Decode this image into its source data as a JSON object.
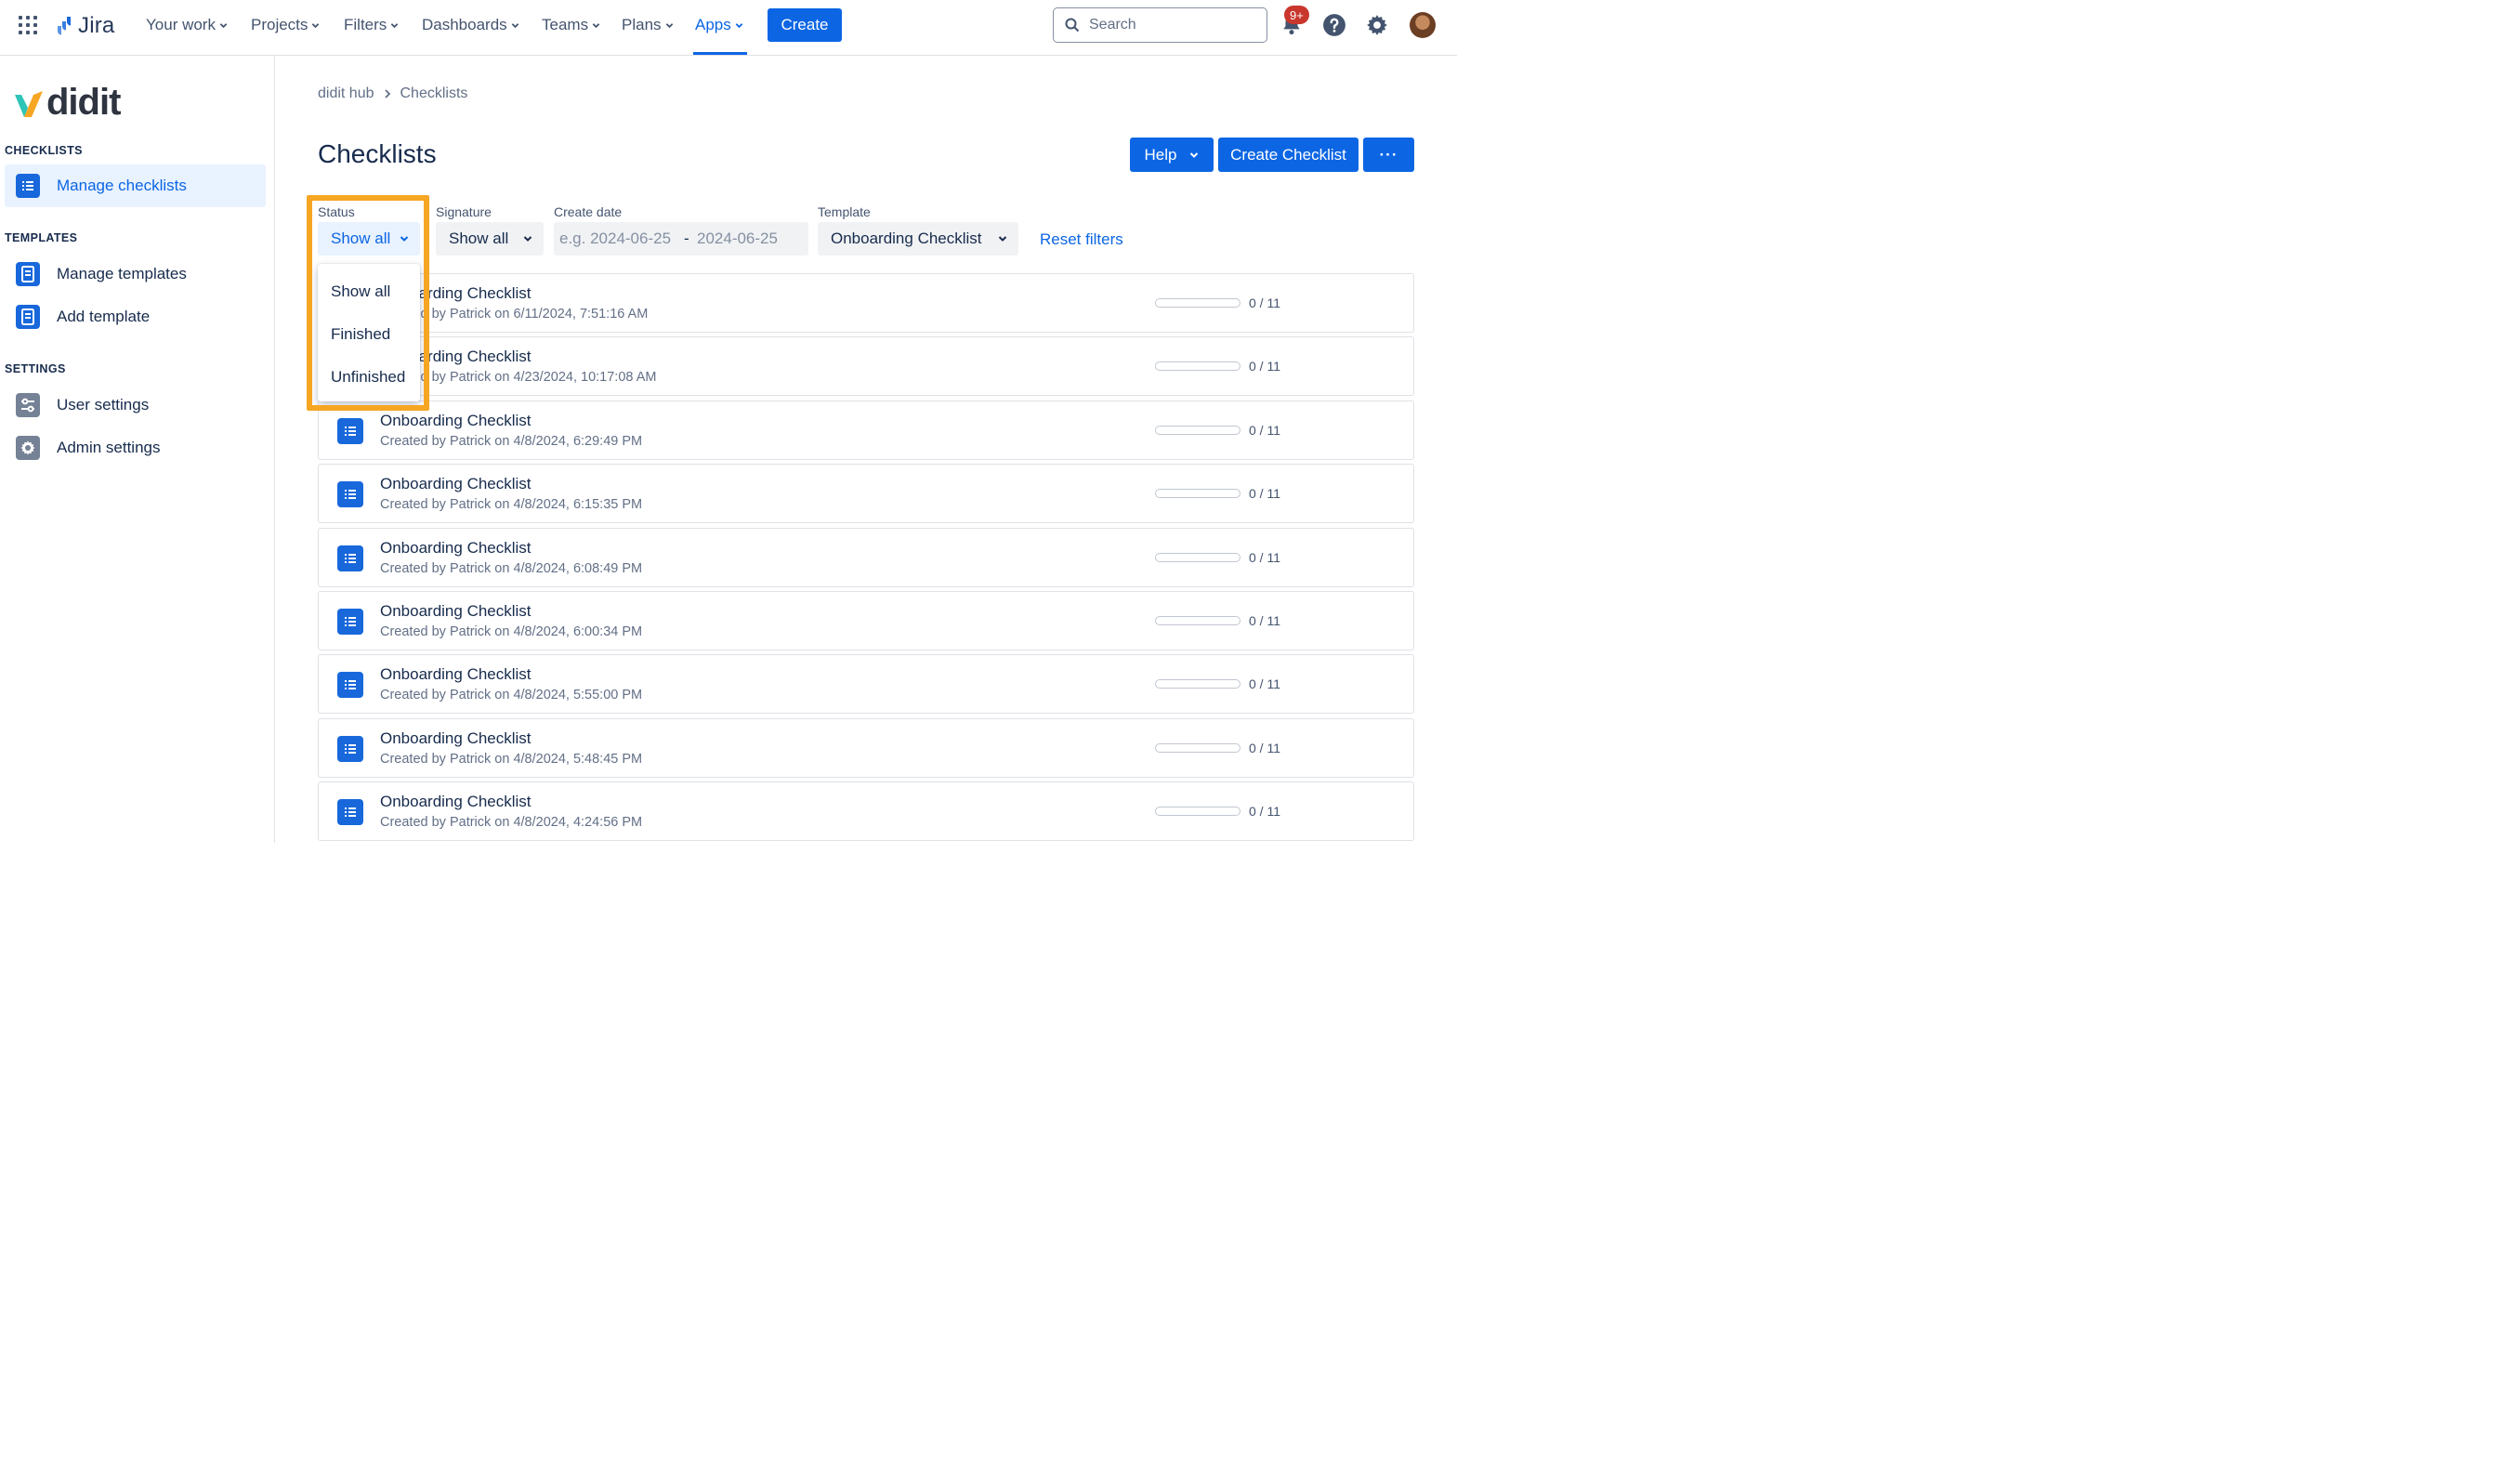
{
  "topnav": {
    "app_name": "Jira",
    "items": [
      {
        "label": "Your work"
      },
      {
        "label": "Projects"
      },
      {
        "label": "Filters"
      },
      {
        "label": "Dashboards"
      },
      {
        "label": "Teams"
      },
      {
        "label": "Plans"
      },
      {
        "label": "Apps",
        "active": true
      }
    ],
    "create_label": "Create",
    "search_placeholder": "Search",
    "notification_badge": "9+"
  },
  "sidebar": {
    "logo_text": "didit",
    "sections": [
      {
        "title": "CHECKLISTS",
        "items": [
          {
            "label": "Manage checklists",
            "icon": "list-icon",
            "selected": true
          }
        ]
      },
      {
        "title": "TEMPLATES",
        "items": [
          {
            "label": "Manage templates",
            "icon": "template-icon"
          },
          {
            "label": "Add template",
            "icon": "template-icon"
          }
        ]
      },
      {
        "title": "SETTINGS",
        "items": [
          {
            "label": "User settings",
            "icon": "sliders-icon"
          },
          {
            "label": "Admin settings",
            "icon": "gear-icon"
          }
        ]
      }
    ]
  },
  "breadcrumb": [
    "didit hub",
    "Checklists"
  ],
  "page": {
    "title": "Checklists",
    "help_label": "Help",
    "create_checklist_label": "Create Checklist",
    "more_label": "···"
  },
  "filters": {
    "status": {
      "label": "Status",
      "value": "Show all",
      "options": [
        "Show all",
        "Finished",
        "Unfinished"
      ]
    },
    "signature": {
      "label": "Signature",
      "value": "Show all"
    },
    "create_date": {
      "label": "Create date",
      "from_placeholder": "e.g. 2024-06-25",
      "separator": "-",
      "to_placeholder": "2024-06-25"
    },
    "template": {
      "label": "Template",
      "value": "Onboarding Checklist"
    },
    "reset_label": "Reset filters"
  },
  "checklists": [
    {
      "title": "Onboarding Checklist",
      "subtitle": "Created by Patrick on 6/11/2024, 7:51:16 AM",
      "progress": "0 / 11",
      "done": 0,
      "total": 11
    },
    {
      "title": "Onboarding Checklist",
      "subtitle": "Created by Patrick on 4/23/2024, 10:17:08 AM",
      "progress": "0 / 11",
      "done": 0,
      "total": 11
    },
    {
      "title": "Onboarding Checklist",
      "subtitle": "Created by Patrick on 4/8/2024, 6:29:49 PM",
      "progress": "0 / 11",
      "done": 0,
      "total": 11
    },
    {
      "title": "Onboarding Checklist",
      "subtitle": "Created by Patrick on 4/8/2024, 6:15:35 PM",
      "progress": "0 / 11",
      "done": 0,
      "total": 11
    },
    {
      "title": "Onboarding Checklist",
      "subtitle": "Created by Patrick on 4/8/2024, 6:08:49 PM",
      "progress": "0 / 11",
      "done": 0,
      "total": 11
    },
    {
      "title": "Onboarding Checklist",
      "subtitle": "Created by Patrick on 4/8/2024, 6:00:34 PM",
      "progress": "0 / 11",
      "done": 0,
      "total": 11
    },
    {
      "title": "Onboarding Checklist",
      "subtitle": "Created by Patrick on 4/8/2024, 5:55:00 PM",
      "progress": "0 / 11",
      "done": 0,
      "total": 11
    },
    {
      "title": "Onboarding Checklist",
      "subtitle": "Created by Patrick on 4/8/2024, 5:48:45 PM",
      "progress": "0 / 11",
      "done": 0,
      "total": 11
    },
    {
      "title": "Onboarding Checklist",
      "subtitle": "Created by Patrick on 4/8/2024, 4:24:56 PM",
      "progress": "0 / 11",
      "done": 0,
      "total": 11
    }
  ],
  "colors": {
    "primary": "#0C66E4",
    "highlight": "#F6A623",
    "badge": "#C9372C"
  }
}
